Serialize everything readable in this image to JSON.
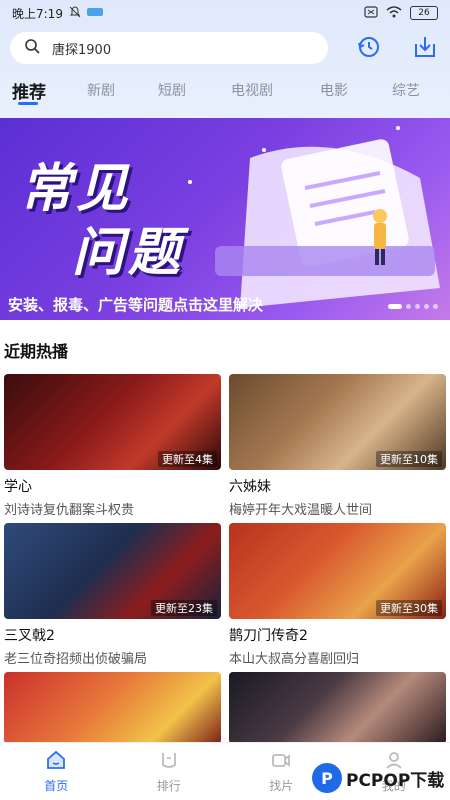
{
  "status_bar": {
    "time": "晚上7:19",
    "battery": "26"
  },
  "search": {
    "text": "唐探1900"
  },
  "tabs": [
    {
      "label": "推荐"
    },
    {
      "label": "新剧"
    },
    {
      "label": "短剧"
    },
    {
      "label": "电视剧"
    },
    {
      "label": "电影"
    },
    {
      "label": "综艺"
    }
  ],
  "banner": {
    "title_line1": "常见",
    "title_line2": "问题",
    "caption": "安装、报毒、广告等问题点击这里解决"
  },
  "section": {
    "title": "近期热播"
  },
  "cards": [
    {
      "name": "学心",
      "desc": "刘诗诗复仇翻案斗权贵",
      "badge": "更新至4集"
    },
    {
      "name": "六姊妹",
      "desc": "梅婷开年大戏温暖人世间",
      "badge": "更新至10集"
    },
    {
      "name": "三叉戟2",
      "desc": "老三位奇招频出侦破骗局",
      "badge": "更新至23集"
    },
    {
      "name": "鹊刀门传奇2",
      "desc": "本山大叔高分喜剧回归",
      "badge": "更新至30集"
    },
    {
      "name": "",
      "desc": "",
      "badge": ""
    },
    {
      "name": "",
      "desc": "",
      "badge": ""
    }
  ],
  "bottom_nav": [
    {
      "label": "首页",
      "icon": "home-icon"
    },
    {
      "label": "排行",
      "icon": "ranking-icon"
    },
    {
      "label": "找片",
      "icon": "video-icon"
    },
    {
      "label": "我的",
      "icon": "profile-icon"
    }
  ],
  "watermark": {
    "logo": "P",
    "text": "PCPOP下载"
  },
  "colors": {
    "accent": "#2a6df4",
    "banner": "#6a38dc"
  }
}
